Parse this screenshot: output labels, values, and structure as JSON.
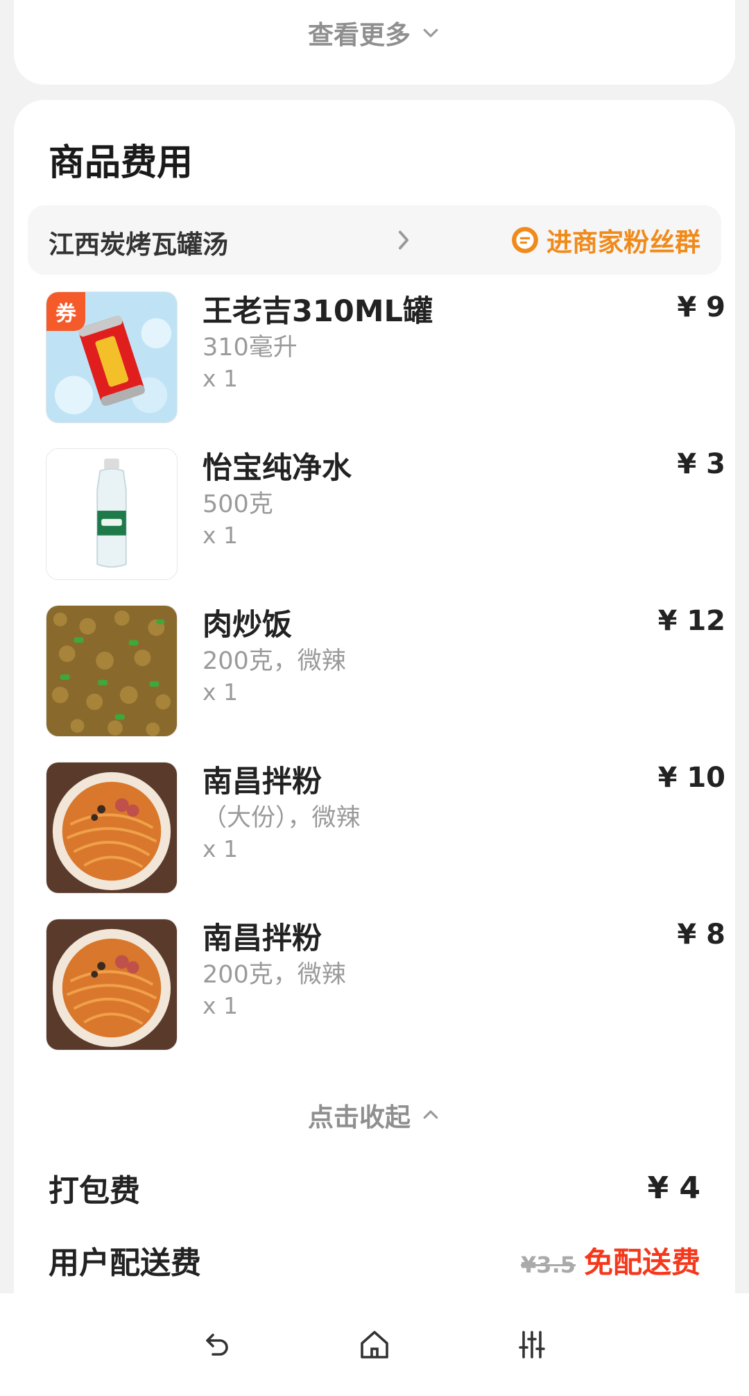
{
  "top_card": {
    "view_more_label": "查看更多"
  },
  "section": {
    "title": "商品费用"
  },
  "shop": {
    "name": "江西炭烤瓦罐汤",
    "fans_label": "进商家粉丝群"
  },
  "items": [
    {
      "name": "王老吉310ML罐",
      "spec": "310毫升",
      "qty": "x 1",
      "price": "¥ 9",
      "badge": "券",
      "image": "red-herbal-tea-can"
    },
    {
      "name": "怡宝纯净水",
      "spec": "500克",
      "qty": "x 1",
      "price": "¥ 3",
      "image": "water-bottle"
    },
    {
      "name": "肉炒饭",
      "spec": "200克，微辣",
      "qty": "x 1",
      "price": "¥ 12",
      "image": "fried-rice"
    },
    {
      "name": "南昌拌粉",
      "spec": "（大份），微辣",
      "qty": "x 1",
      "price": "¥ 10",
      "image": "rice-noodles"
    },
    {
      "name": "南昌拌粉",
      "spec": "200克，微辣",
      "qty": "x 1",
      "price": "¥ 8",
      "image": "rice-noodles"
    }
  ],
  "collapse_label": "点击收起",
  "fees": {
    "packing_label": "打包费",
    "packing_value": "¥ 4",
    "delivery_label": "用户配送费",
    "delivery_old_price": "¥3.5",
    "delivery_free_label": "免配送费"
  },
  "colors": {
    "accent_orange": "#f08a1a",
    "accent_red": "#f5381c",
    "coupon": "#f45a2a"
  },
  "nav": {
    "icons": [
      "back-icon",
      "home-icon",
      "settings-sliders-icon"
    ]
  }
}
